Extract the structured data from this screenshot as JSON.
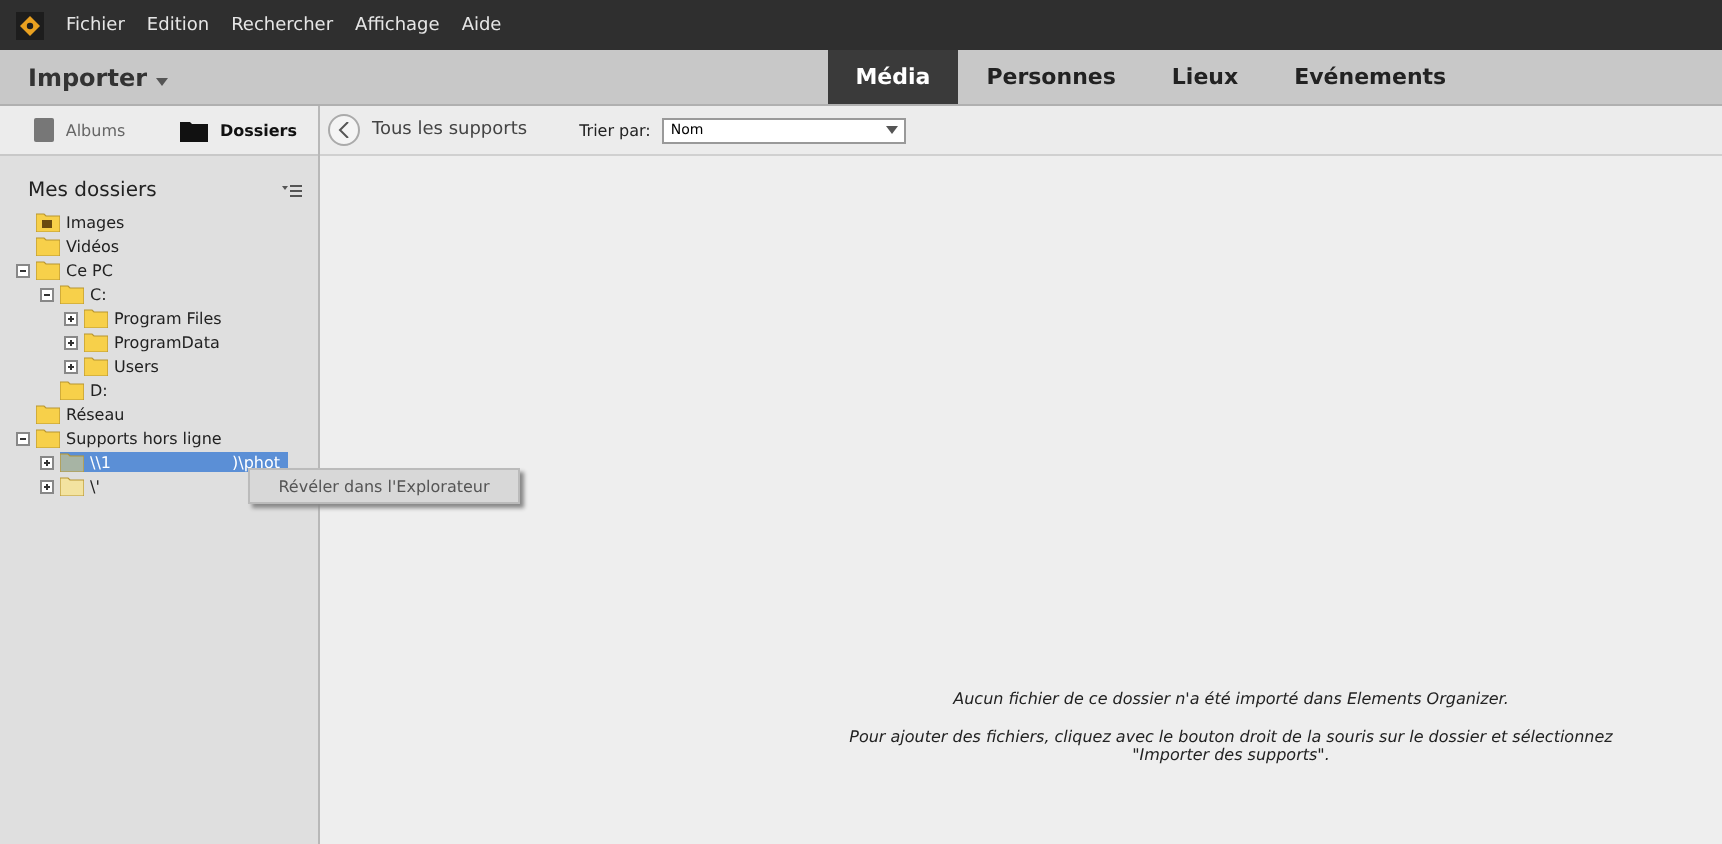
{
  "menu_bar": [
    "Fichier",
    "Edition",
    "Rechercher",
    "Affichage",
    "Aide"
  ],
  "header": {
    "title": "Importer",
    "tabs": [
      {
        "label": "Média",
        "selected": true
      },
      {
        "label": "Personnes",
        "selected": false
      },
      {
        "label": "Lieux",
        "selected": false
      },
      {
        "label": "Evénements",
        "selected": false
      }
    ]
  },
  "sidebar": {
    "tabs": [
      {
        "label": "Albums",
        "kind": "album",
        "selected": false
      },
      {
        "label": "Dossiers",
        "kind": "folder",
        "selected": true
      }
    ],
    "title": "Mes dossiers",
    "tree": [
      {
        "label": "Images",
        "kind": "pictures",
        "selected": false
      },
      {
        "label": "Vidéos",
        "kind": "folder",
        "selected": false
      },
      {
        "label": "Ce PC",
        "kind": "folder",
        "selected": false,
        "expanded": true,
        "children": [
          {
            "label": "C:",
            "kind": "folder",
            "selected": false,
            "expanded": true,
            "children": [
              {
                "label": "Program Files",
                "kind": "folder",
                "selected": false,
                "expanded": false
              },
              {
                "label": "ProgramData",
                "kind": "folder",
                "selected": false,
                "expanded": false
              },
              {
                "label": "Users",
                "kind": "folder",
                "selected": false,
                "expanded": false
              }
            ]
          },
          {
            "label": "D:",
            "kind": "folder",
            "selected": false
          }
        ]
      },
      {
        "label": "Réseau",
        "kind": "folder",
        "selected": false
      },
      {
        "label": "Supports hors ligne",
        "kind": "folder",
        "selected": false,
        "expanded": true,
        "children": [
          {
            "label": "\\\\1",
            "suffix": ")\\phot",
            "kind": "offline",
            "selected": true,
            "expanded": false
          },
          {
            "label": "\\'",
            "kind": "offline-folder",
            "selected": false,
            "expanded": false
          }
        ]
      }
    ]
  },
  "context_menu": [
    "Révéler dans l'Explorateur"
  ],
  "toolbar": {
    "breadcrumb": "Tous les supports",
    "sort_label": "Trier par:",
    "sort_value": "Nom"
  },
  "empty_message": [
    "Aucun fichier de ce dossier n'a été importé dans Elements Organizer.",
    "Pour ajouter des fichiers, cliquez avec le bouton droit de la souris sur le dossier et sélectionnez \"Importer des supports\"."
  ]
}
